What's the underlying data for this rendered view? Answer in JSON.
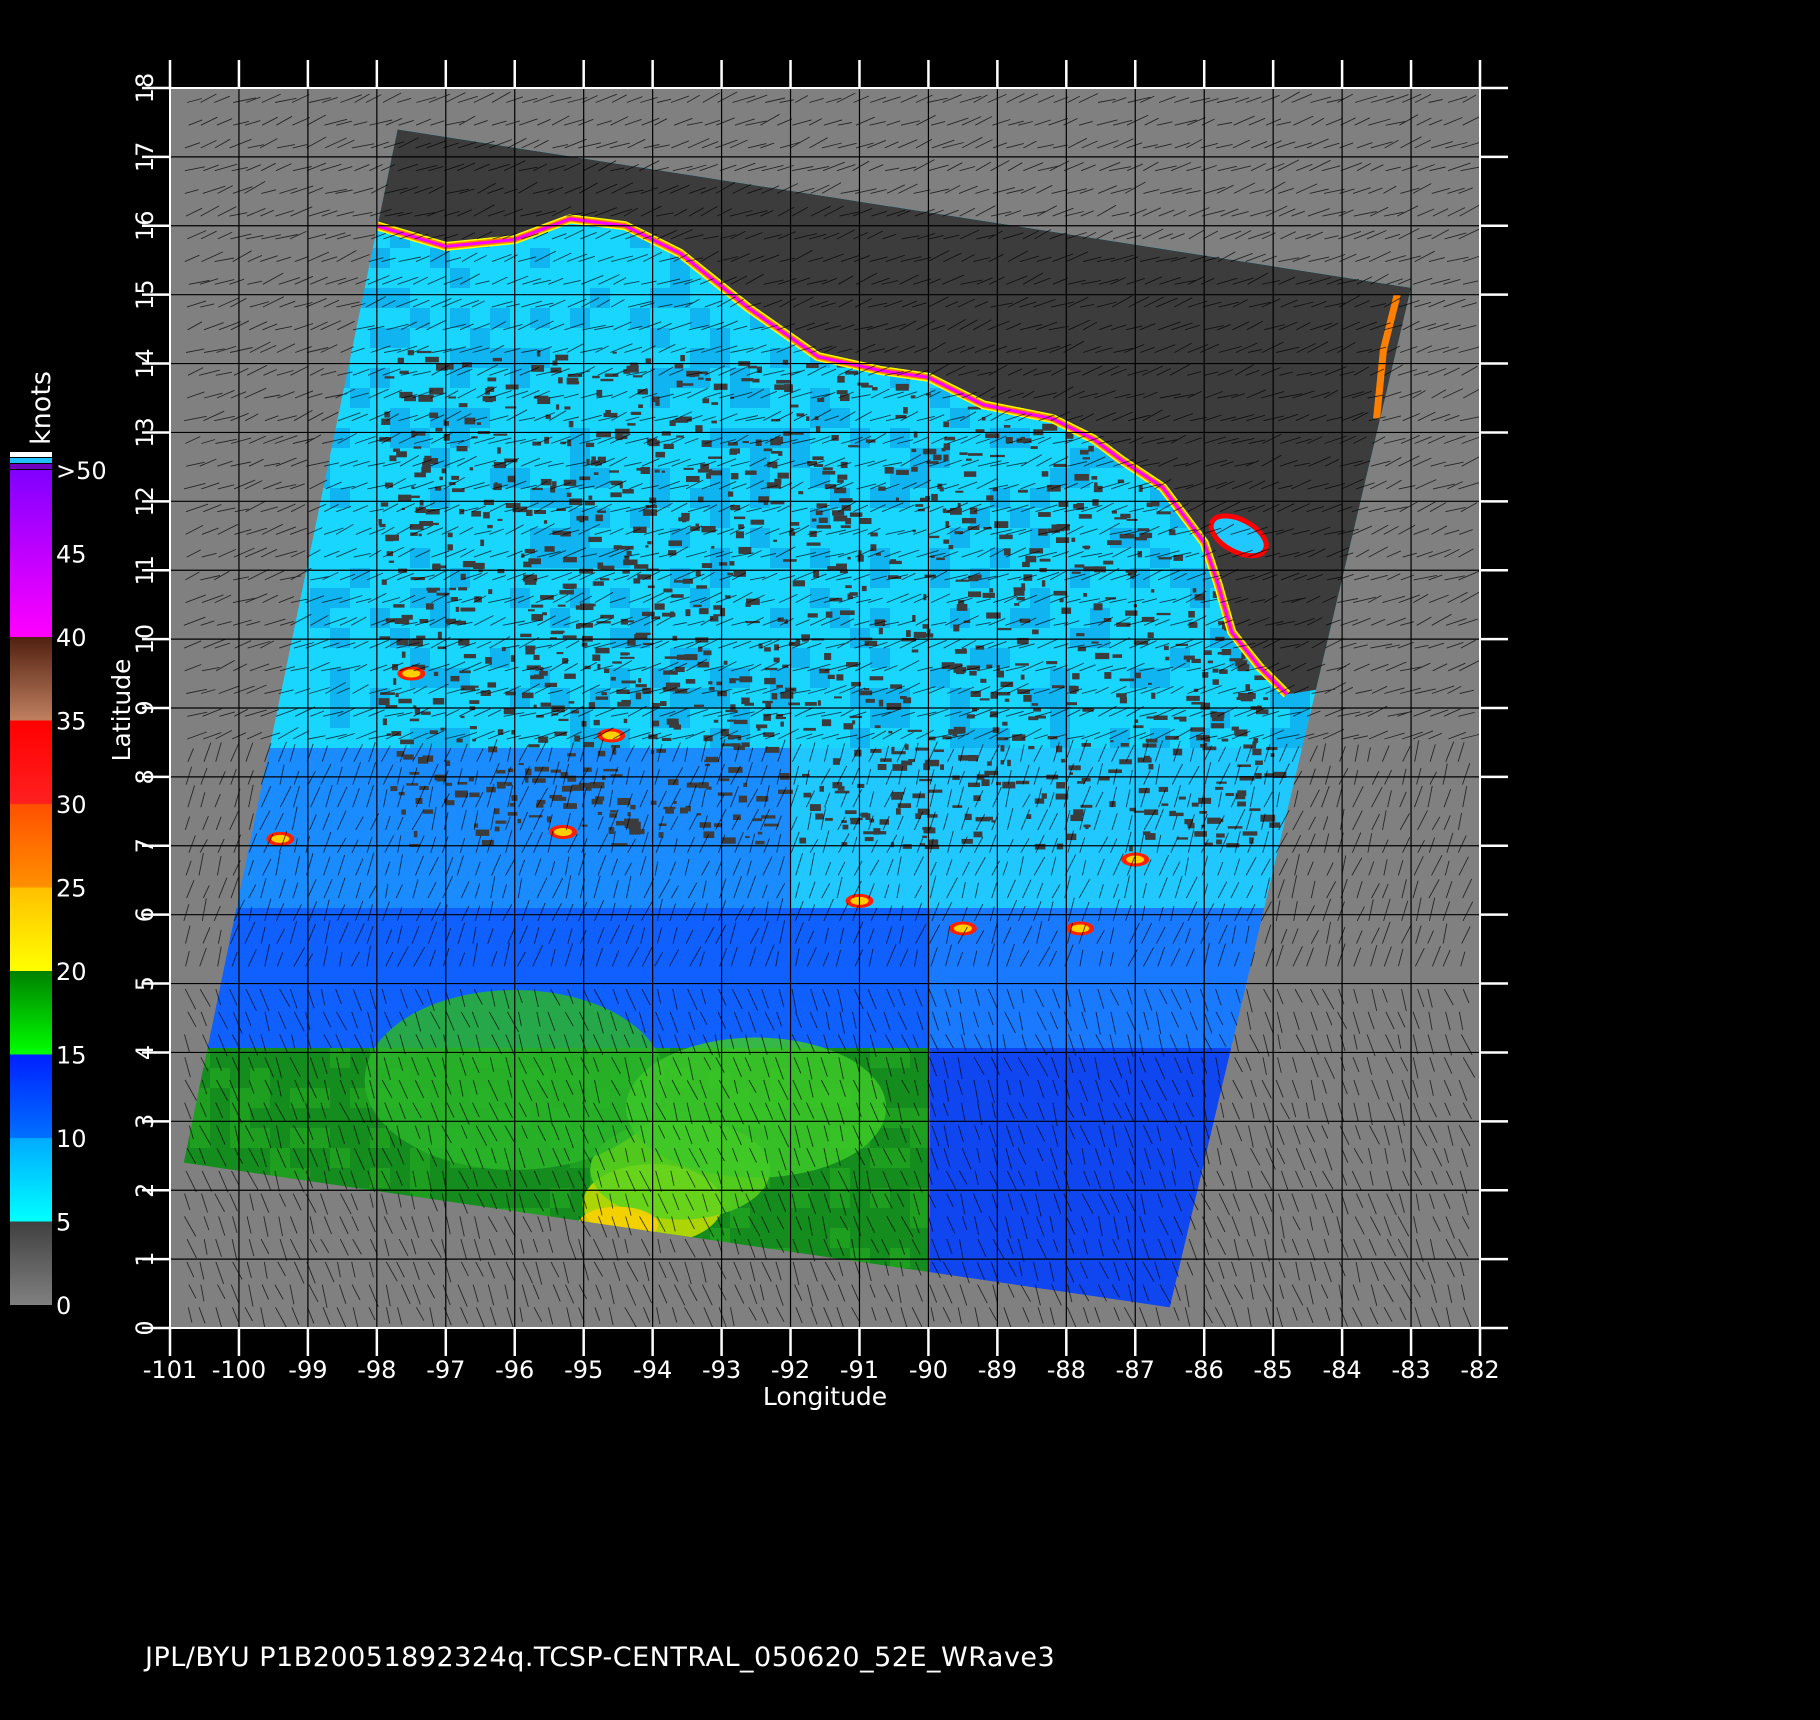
{
  "map": {
    "lon_range": [
      -101,
      -82
    ],
    "lat_range": [
      0,
      18
    ],
    "lon_ticks": [
      "-101",
      "-100",
      "-99",
      "-98",
      "-97",
      "-96",
      "-95",
      "-94",
      "-93",
      "-92",
      "-91",
      "-90",
      "-89",
      "-88",
      "-87",
      "-86",
      "-85",
      "-84",
      "-83",
      "-82"
    ],
    "lat_ticks": [
      "0",
      "1",
      "2",
      "3",
      "4",
      "5",
      "6",
      "7",
      "8",
      "9",
      "10",
      "11",
      "12",
      "13",
      "14",
      "15",
      "16",
      "17",
      "18"
    ],
    "xlabel": "Longitude",
    "ylabel": "Latitude",
    "background_color": "#808080",
    "swath_corners_lonlat": [
      [
        -97.7,
        17.4
      ],
      [
        -83.0,
        15.1
      ],
      [
        -86.5,
        0.3
      ],
      [
        -100.8,
        2.4
      ]
    ],
    "coast_color_ramp": [
      "#ffff00",
      "#ff8000",
      "#ff0000",
      "#ff00ff"
    ]
  },
  "colorbar": {
    "title": "knots",
    "labels": [
      ">50",
      "45",
      "40",
      "35",
      "30",
      "25",
      "20",
      "15",
      "10",
      "5",
      "0"
    ],
    "bands": [
      {
        "from": 0,
        "to": 5,
        "top": "#404040",
        "bottom": "#808080"
      },
      {
        "from": 5,
        "to": 10,
        "top": "#00aaff",
        "bottom": "#00ffff"
      },
      {
        "from": 10,
        "to": 15,
        "top": "#0020ff",
        "bottom": "#0070ff"
      },
      {
        "from": 15,
        "to": 20,
        "top": "#008000",
        "bottom": "#00ff00"
      },
      {
        "from": 20,
        "to": 25,
        "top": "#ffc000",
        "bottom": "#ffff00"
      },
      {
        "from": 25,
        "to": 30,
        "top": "#ff5000",
        "bottom": "#ff9000"
      },
      {
        "from": 30,
        "to": 35,
        "top": "#ff0000",
        "bottom": "#ff2020"
      },
      {
        "from": 35,
        "to": 40,
        "top": "#502010",
        "bottom": "#c08060"
      },
      {
        "from": 40,
        "to": 50,
        "top": "#8000ff",
        "bottom": "#ff00ff"
      }
    ]
  },
  "footer": "JPL/BYU  P1B20051892324q.TCSP-CENTRAL_050620_52E_WRave3"
}
